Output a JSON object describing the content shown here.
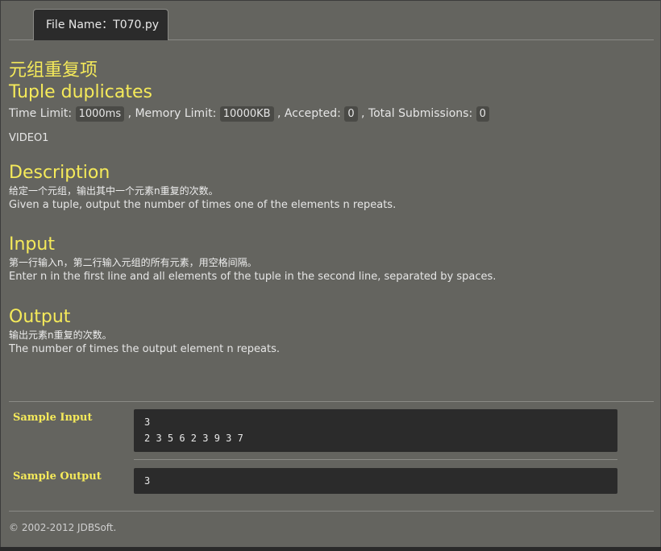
{
  "tab": {
    "label": "File Name：T070.py"
  },
  "problem": {
    "title_cn": "元组重复项",
    "title_en": "Tuple duplicates",
    "limits": {
      "time_label": "Time Limit:",
      "time_value": "1000ms",
      "memory_label": ", Memory Limit:",
      "memory_value": "10000KB",
      "accepted_label": ", Accepted:",
      "accepted_value": "0",
      "submissions_label": ", Total Submissions:",
      "submissions_value": "0"
    },
    "video_label": "VIDEO1"
  },
  "description": {
    "heading": "Description",
    "text_cn": "给定一个元组，输出其中一个元素n重复的次数。",
    "text_en": "Given a tuple, output the number of times one of the elements n repeats."
  },
  "input": {
    "heading": "Input",
    "text_cn": "第一行输入n，第二行输入元组的所有元素，用空格间隔。",
    "text_en": "Enter n in the first line and all elements of the tuple in the second line, separated by spaces."
  },
  "output": {
    "heading": "Output",
    "text_cn": "输出元素n重复的次数。",
    "text_en": "The number of times the output element n repeats."
  },
  "samples": {
    "input_label": "Sample Input",
    "input_lines": [
      "3",
      "2 3 5 6 2 3 9 3 7"
    ],
    "output_label": "Sample Output",
    "output_lines": [
      "3"
    ]
  },
  "footer": {
    "copyright": "© 2002-2012  JDBSoft."
  }
}
